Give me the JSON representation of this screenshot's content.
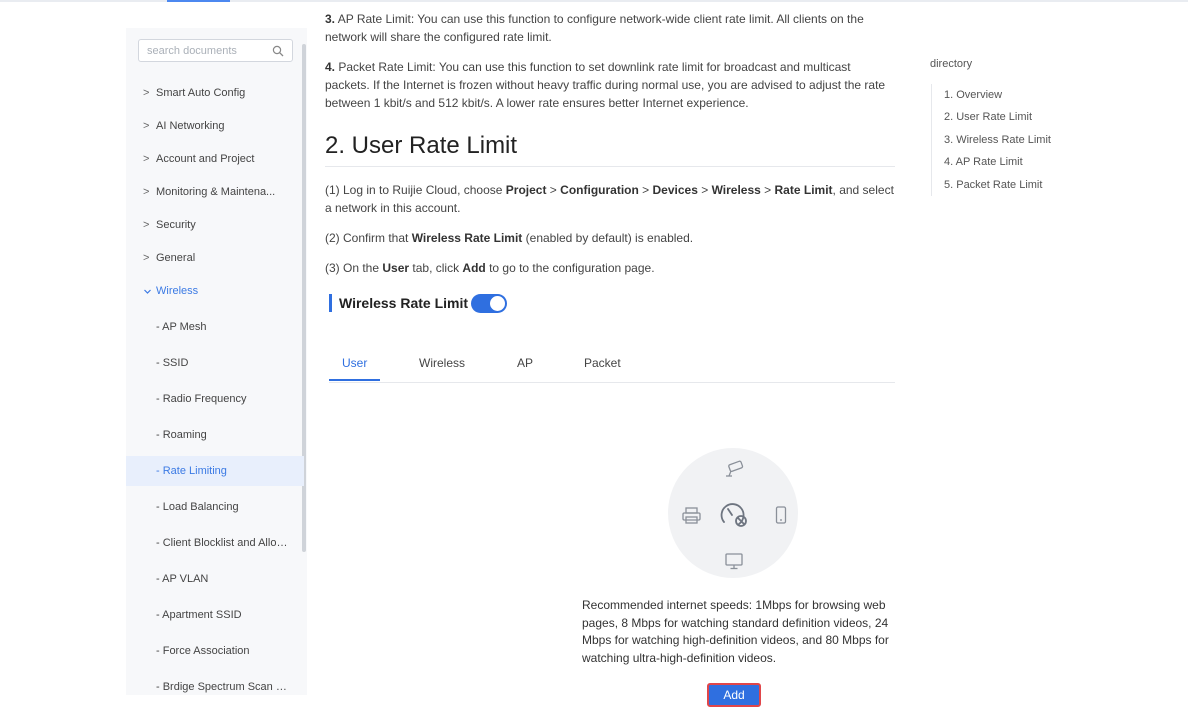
{
  "search": {
    "placeholder": "search documents",
    "icon": "search-icon"
  },
  "sidebar": {
    "items": [
      {
        "label": "Smart Auto Config"
      },
      {
        "label": "AI Networking"
      },
      {
        "label": "Account and Project"
      },
      {
        "label": "Monitoring & Maintena..."
      },
      {
        "label": "Security"
      },
      {
        "label": "General"
      },
      {
        "label": "Wireless"
      }
    ],
    "sub_items": [
      {
        "label": "- AP Mesh"
      },
      {
        "label": "- SSID"
      },
      {
        "label": "- Radio Frequency"
      },
      {
        "label": "- Roaming"
      },
      {
        "label": "- Rate Limiting"
      },
      {
        "label": "- Load Balancing"
      },
      {
        "label": "- Client Blocklist and Allowl..."
      },
      {
        "label": "- AP VLAN"
      },
      {
        "label": "- Apartment SSID"
      },
      {
        "label": "- Force Association"
      },
      {
        "label": "- Brdige Spectrum Scan an..."
      }
    ],
    "active_item": "Wireless",
    "selected_sub_item": "- Rate Limiting"
  },
  "content": {
    "p3_num": "3.",
    "p3_text": " AP Rate Limit: You can use this function to configure network-wide client rate limit. All clients on the network will share the configured rate limit.",
    "p4_num": "4.",
    "p4_text": " Packet Rate Limit: You can use this function to set downlink rate limit for broadcast and multicast packets. If the Internet is frozen without heavy traffic during normal use, you are advised to adjust the rate between 1 kbit/s and 512 kbit/s. A lower rate ensures better Internet experience.",
    "heading": "2. User Rate Limit",
    "step1": {
      "prefix": "(1) Log in to Ruijie Cloud, choose ",
      "b1": "Project",
      "sep1": " > ",
      "b2": "Configuration",
      "sep2": " > ",
      "b3": "Devices",
      "sep3": " > ",
      "b4": "Wireless",
      "sep4": " > ",
      "b5": "Rate Limit",
      "suffix": ", and select a network in this account."
    },
    "step2": {
      "prefix": "(2) Confirm that ",
      "bold": "Wireless Rate Limit",
      "suffix": " (enabled by default) is enabled."
    },
    "step3": {
      "prefix": "(3) On the ",
      "bold1": "User",
      "middle": " tab, click ",
      "bold2": "Add",
      "suffix": " to go to the configuration page."
    }
  },
  "toggle": {
    "label": "Wireless Rate Limit",
    "enabled": true
  },
  "tabs": [
    {
      "label": "User",
      "active": true
    },
    {
      "label": "Wireless"
    },
    {
      "label": "AP"
    },
    {
      "label": "Packet"
    }
  ],
  "empty_state": {
    "recommendation": "Recommended internet speeds: 1Mbps for browsing web pages, 8 Mbps for watching standard definition videos, 24 Mbps for watching high-definition videos, and 80 Mbps for watching ultra-high-definition videos.",
    "add_label": "Add"
  },
  "directory": {
    "title": "directory",
    "items": [
      {
        "label": "1. Overview"
      },
      {
        "label": "2. User Rate Limit"
      },
      {
        "label": "3. Wireless Rate Limit"
      },
      {
        "label": "4. AP Rate Limit"
      },
      {
        "label": "5. Packet Rate Limit"
      }
    ]
  },
  "colors": {
    "accent": "#2f6fe0",
    "sidebar_bg": "#f7f8fa",
    "selected_bg": "#e8effc",
    "add_outline": "#e0464a"
  }
}
